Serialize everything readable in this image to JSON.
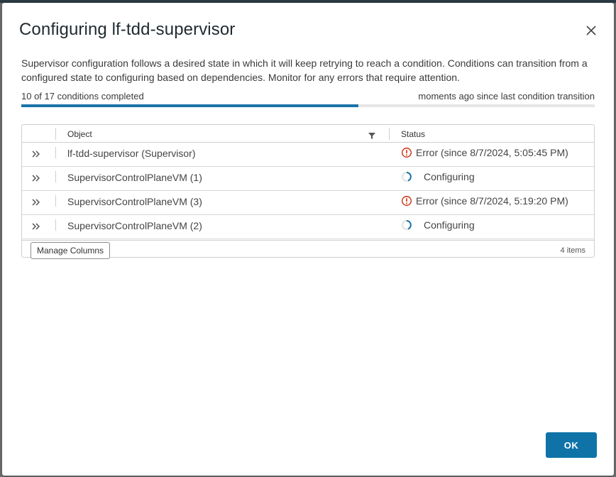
{
  "dialog": {
    "title": "Configuring lf-tdd-supervisor",
    "description": "Supervisor configuration follows a desired state in which it will keep retrying to reach a condition. Conditions can transition from a configured state to configuring based on dependencies. Monitor for any errors that require attention.",
    "progress": {
      "completed_label": "10 of 17 conditions completed",
      "last_transition": "moments ago since last condition transition",
      "completed": 10,
      "total": 17,
      "fraction": 0.588
    },
    "close_icon": "close-icon",
    "ok_label": "OK"
  },
  "grid": {
    "columns": {
      "object": "Object",
      "status": "Status"
    },
    "filter_icon": "filter-icon",
    "rows": [
      {
        "object": "lf-tdd-supervisor (Supervisor)",
        "status": "Error (since 8/7/2024, 5:05:45 PM)",
        "state": "error"
      },
      {
        "object": "SupervisorControlPlaneVM (1)",
        "status": "Configuring",
        "state": "configuring"
      },
      {
        "object": "SupervisorControlPlaneVM (3)",
        "status": "Error (since 8/7/2024, 5:19:20 PM)",
        "state": "error"
      },
      {
        "object": "SupervisorControlPlaneVM (2)",
        "status": "Configuring",
        "state": "configuring"
      }
    ],
    "footer": {
      "manage_columns_label": "Manage Columns",
      "item_count": "4 items"
    }
  },
  "colors": {
    "accent": "#0f73a8",
    "progress": "#1a73a8",
    "error": "#c92100",
    "spinner": "#1a73a8"
  }
}
